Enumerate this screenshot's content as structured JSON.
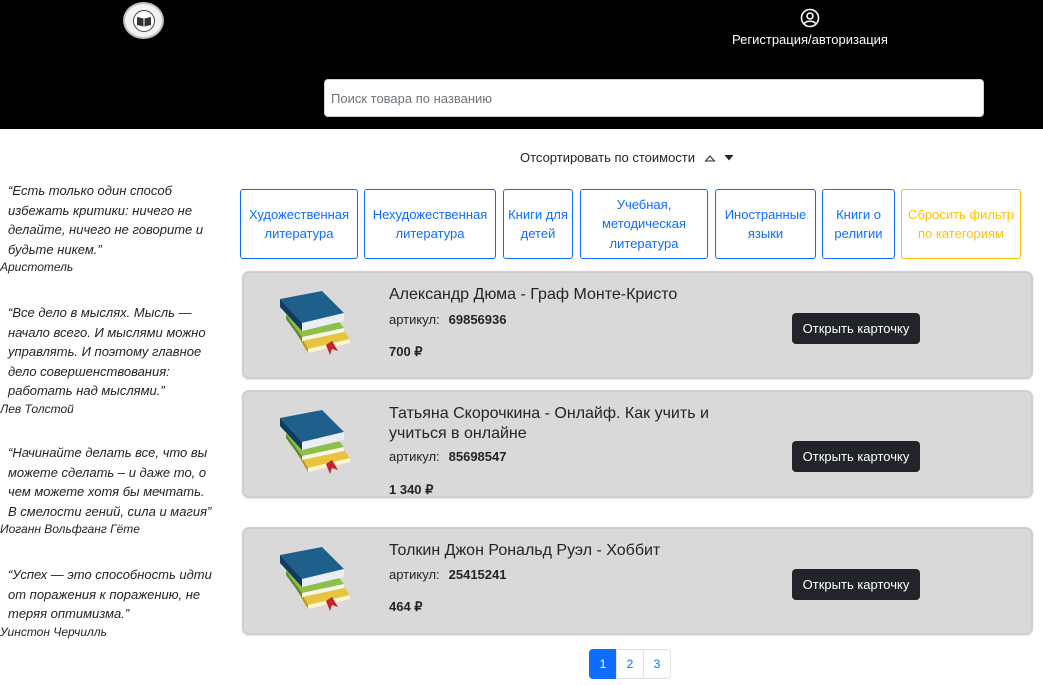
{
  "header": {
    "logo_icon": "book-logo-icon",
    "auth_icon": "user-circle-icon",
    "auth_label": "Регистрация/авторизация"
  },
  "search": {
    "placeholder": "Поиск товара по названию",
    "value": ""
  },
  "sort": {
    "label": "Отсортировать по стоимости",
    "asc_icon": "caret-up-icon",
    "desc_icon": "caret-down-icon"
  },
  "categories": [
    {
      "label": "Художественная литература"
    },
    {
      "label": "Нехудожественная литература"
    },
    {
      "label": "Книги для детей"
    },
    {
      "label": "Учебная, методическая литература"
    },
    {
      "label": "Иностранные языки"
    },
    {
      "label": "Книги о религии"
    },
    {
      "label": "Сбросить фильтр по категориям"
    }
  ],
  "quotes": [
    {
      "text": "“Есть только один способ избежать критики: ничего не делайте, ничего не говорите и будьте никем.”",
      "author": "Аристотель"
    },
    {
      "text": "“Все дело в мыслях. Мысль — начало всего. И мыслями можно управлять. И поэтому главное дело совершенствования: работать над мыслями.”",
      "author": "Лев Толстой"
    },
    {
      "text": "“Начинайте делать все, что вы можете сделать – и даже то, о чем можете хотя бы мечтать. В смелости гений, сила и магия”",
      "author": "Иоганн Вольфганг Гёте"
    },
    {
      "text": "“Успех — это способность идти от поражения к поражению, не теряя оптимизма.”",
      "author": "Уинстон Черчилль"
    }
  ],
  "products": [
    {
      "title": "Александр Дюма - Граф Монте-Кристо",
      "sku_label": "артикул:",
      "sku": "69856936",
      "price": "700 ₽",
      "button": "Открыть карточку"
    },
    {
      "title": "Татьяна Скорочкина - Онлайф. Как учить и учиться в онлайне",
      "sku_label": "артикул:",
      "sku": "85698547",
      "price": "1 340 ₽",
      "button": "Открыть карточку"
    },
    {
      "title": "Толкин Джон Рональд Руэл - Хоббит",
      "sku_label": "артикул:",
      "sku": "25415241",
      "price": "464 ₽",
      "button": "Открыть карточку"
    }
  ],
  "pagination": {
    "pages": [
      "1",
      "2",
      "3"
    ],
    "current": "1"
  },
  "colors": {
    "header_bg": "#000000",
    "accent": "#0d6efd",
    "warning": "#ffc107",
    "card_bg": "#d9d9d9",
    "button_dark": "#212529"
  }
}
